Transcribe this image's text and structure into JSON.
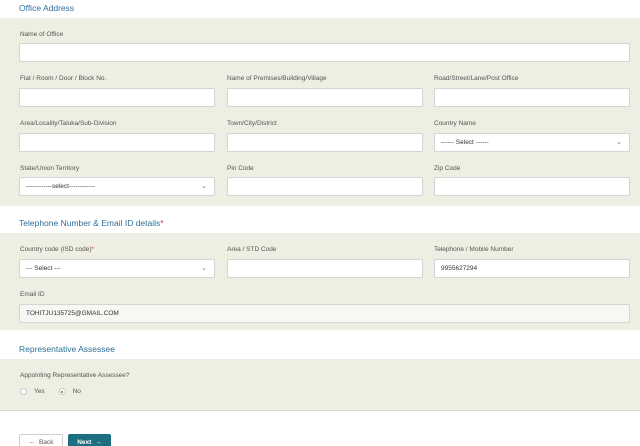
{
  "office": {
    "section_title": "Office Address",
    "name_of_office": {
      "label": "Name of Office",
      "value": ""
    },
    "flat": {
      "label": "Flat / Room / Door / Block No.",
      "value": ""
    },
    "premises": {
      "label": "Name of Premises/Building/Village",
      "value": ""
    },
    "road": {
      "label": "Road/Street/Lane/Post Office",
      "value": ""
    },
    "locality": {
      "label": "Area/Locality/Taluka/Sub-Division",
      "value": ""
    },
    "town": {
      "label": "Town/City/District",
      "value": ""
    },
    "country": {
      "label": "Country Name",
      "value": "------ Select ------"
    },
    "state": {
      "label": "State/Union Territory",
      "value": "------------select------------"
    },
    "pin": {
      "label": "Pin Code",
      "value": ""
    },
    "zip": {
      "label": "Zip Code",
      "value": ""
    }
  },
  "contact": {
    "section_title": "Telephone Number & Email ID details",
    "required_mark": "*",
    "country_code": {
      "label": "Country code (ISD code)",
      "required_mark": "*",
      "value": "--- Select ---"
    },
    "std_code": {
      "label": "Area / STD Code",
      "value": ""
    },
    "mobile": {
      "label": "Telephone / Mobile Number",
      "value": "9955627294"
    },
    "email": {
      "label": "Email ID",
      "value": "TOHITJU135725@GMAIL.COM"
    }
  },
  "representative": {
    "section_title": "Representative Assessee",
    "question": "Appointing Representative Assessee?",
    "options": [
      "Yes",
      "No"
    ],
    "selected": "No"
  },
  "buttons": {
    "back_label": "Back",
    "back_icon": "arrow-left-icon",
    "next_label": "Next",
    "next_icon": "arrow-right-icon"
  },
  "colors": {
    "panel_background": "#eeeee2",
    "section_title": "#2e6f9a",
    "required": "#d9342b",
    "next_button": "#1b6f7e"
  }
}
